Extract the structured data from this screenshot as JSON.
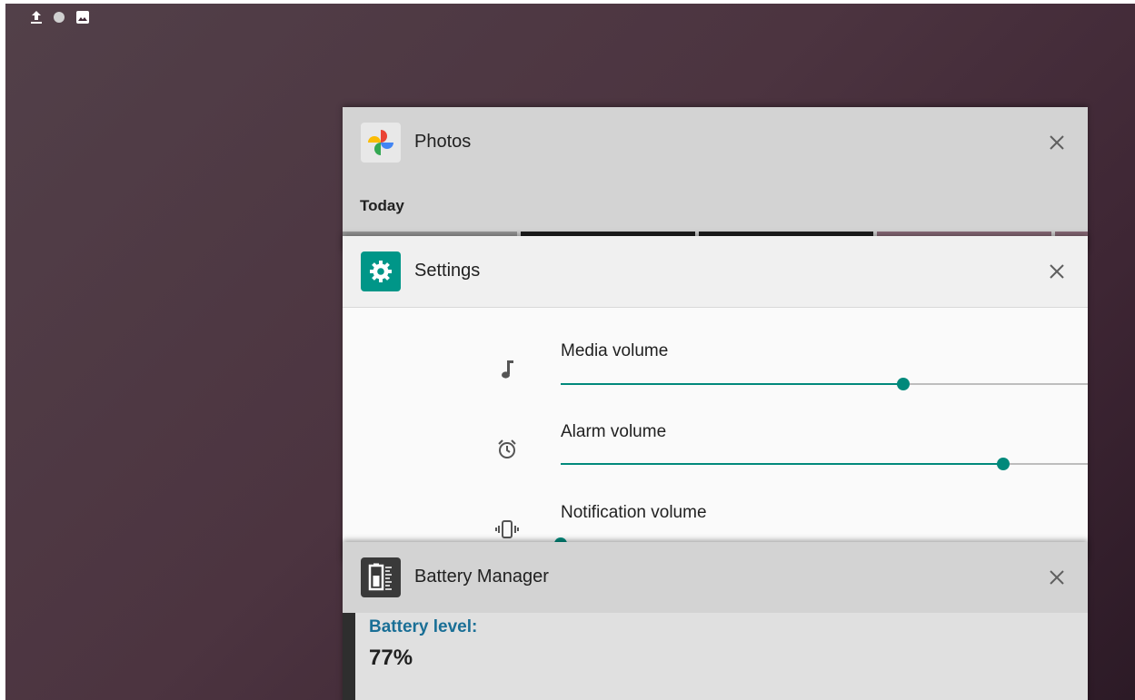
{
  "status_bar": {
    "icons": [
      "upload-icon",
      "circle-icon",
      "image-icon"
    ]
  },
  "recents": {
    "photos": {
      "title": "Photos",
      "section_label": "Today"
    },
    "settings": {
      "title": "Settings",
      "volumes": [
        {
          "label": "Media volume",
          "icon": "music-note-icon",
          "level": 0.65
        },
        {
          "label": "Alarm volume",
          "icon": "alarm-clock-icon",
          "level": 0.84
        },
        {
          "label": "Notification volume",
          "icon": "vibrate-icon",
          "level": 0.0
        }
      ]
    },
    "battery": {
      "title": "Battery Manager",
      "level_label": "Battery level:",
      "level_value": "77%"
    }
  },
  "colors": {
    "accent": "#00897b",
    "battery_label": "#1a6f96"
  }
}
